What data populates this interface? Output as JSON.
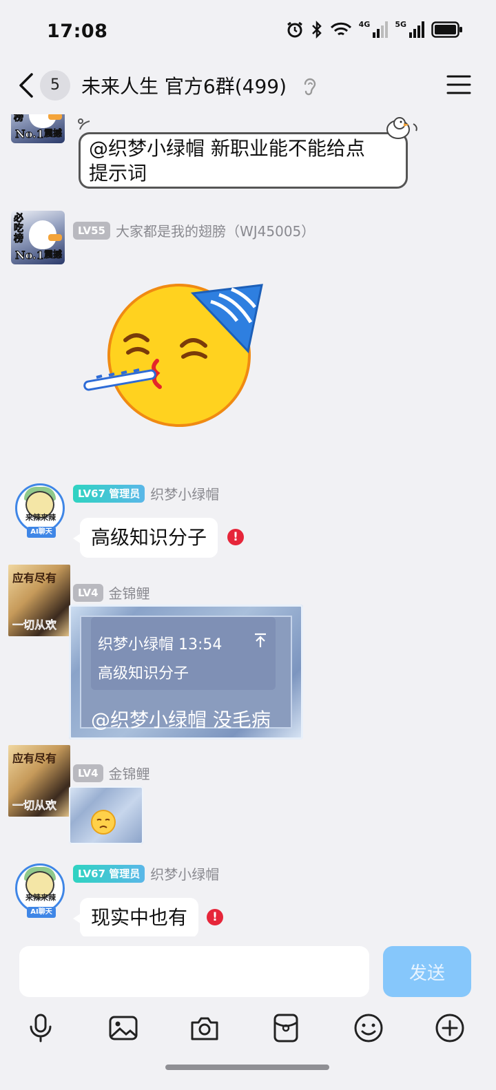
{
  "status_bar": {
    "time": "17:08",
    "net1": "4G",
    "net2": "5G"
  },
  "header": {
    "unread_count": "5",
    "title": "未来人生 官方6群(499)"
  },
  "messages": {
    "m1": {
      "text_line1": "@织梦小绿帽 新职业能不能给点",
      "text_line2": "提示词",
      "avatar_no1": "No.1",
      "avatar_cjk": "必吃榜",
      "avatar_stamp": "震撼"
    },
    "m2": {
      "level": "LV55",
      "nick": "大家都是我的翅膀（WJ45005）",
      "avatar_no1": "No.1",
      "avatar_cjk": "必吃榜",
      "avatar_stamp": "震撼"
    },
    "m3": {
      "level": "LV67 管理员",
      "nick": "织梦小绿帽",
      "text": "高级知识分子",
      "avatar_text": "来辣来辣",
      "ai_tag": "AI聊天"
    },
    "m4": {
      "level": "LV4",
      "nick": "金锦鲤",
      "quote_head": "织梦小绿帽 13:54",
      "quote_body": "高级知识分子",
      "text": "@织梦小绿帽 没毛病",
      "avatar_top": "应有尽有",
      "avatar_bottom": "一切从欢"
    },
    "m5": {
      "level": "LV4",
      "nick": "金锦鲤",
      "avatar_top": "应有尽有",
      "avatar_bottom": "一切从欢"
    },
    "m6": {
      "level": "LV67 管理员",
      "nick": "织梦小绿帽",
      "text": "现实中也有",
      "avatar_text": "来辣来辣",
      "ai_tag": "AI聊天"
    }
  },
  "composer": {
    "value": "",
    "send_label": "发送"
  },
  "colors": {
    "accent": "#86c7fb",
    "error": "#e6263a",
    "admin_badge": "#2fd3c1"
  }
}
